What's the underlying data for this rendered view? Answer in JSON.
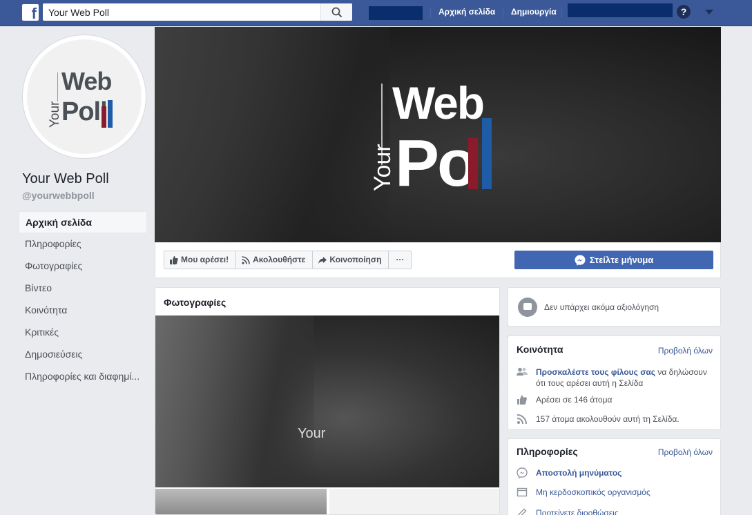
{
  "topbar": {
    "search_value": "Your Web Poll",
    "nav_home": "Αρχική σελίδα",
    "nav_create": "Δημιουργία",
    "help": "?"
  },
  "profile": {
    "logo_your": "Your",
    "logo_web": "Web",
    "logo_poll": "Poll",
    "name": "Your Web Poll",
    "handle": "@yourwebbpoll"
  },
  "sidebar": {
    "items": [
      {
        "label": "Αρχική σελίδα",
        "active": true
      },
      {
        "label": "Πληροφορίες"
      },
      {
        "label": "Φωτογραφίες"
      },
      {
        "label": "Βίντεο"
      },
      {
        "label": "Κοινότητα"
      },
      {
        "label": "Κριτικές"
      },
      {
        "label": "Δημοσιεύσεις"
      },
      {
        "label": "Πληροφορίες και διαφημί..."
      }
    ]
  },
  "cover": {
    "your": "Your",
    "web": "Web",
    "po": "Po"
  },
  "actions": {
    "like": "Μου αρέσει!",
    "follow": "Ακολουθήστε",
    "share": "Κοινοποίηση",
    "more": "···",
    "message": "Στείλτε μήνυμα"
  },
  "photos": {
    "title": "Φωτογραφίες",
    "overlay_text": "Your"
  },
  "reviews": {
    "text": "Δεν υπάρχει ακόμα αξιολόγηση"
  },
  "community": {
    "title": "Κοινότητα",
    "see_all": "Προβολή όλων",
    "invite_link": "Προσκαλέστε τους φίλους σας",
    "invite_rest": " να δηλώσουν ότι τους αρέσει αυτή η Σελίδα",
    "likes": "Αρέσει σε 146 άτομα",
    "follows": "157 άτομα ακολουθούν αυτή τη Σελίδα."
  },
  "about": {
    "title": "Πληροφορίες",
    "see_all": "Προβολή όλων",
    "send_message": "Αποστολή μηνύματος",
    "nonprofit": "Μη κερδοσκοπικός οργανισμός",
    "suggest_edits": "Προτείνετε διορθώσεις"
  },
  "colors": {
    "brand": "#3b5998",
    "button": "#4267b2",
    "logo_red": "#8b1a2b",
    "logo_blue": "#1f5ca8"
  }
}
